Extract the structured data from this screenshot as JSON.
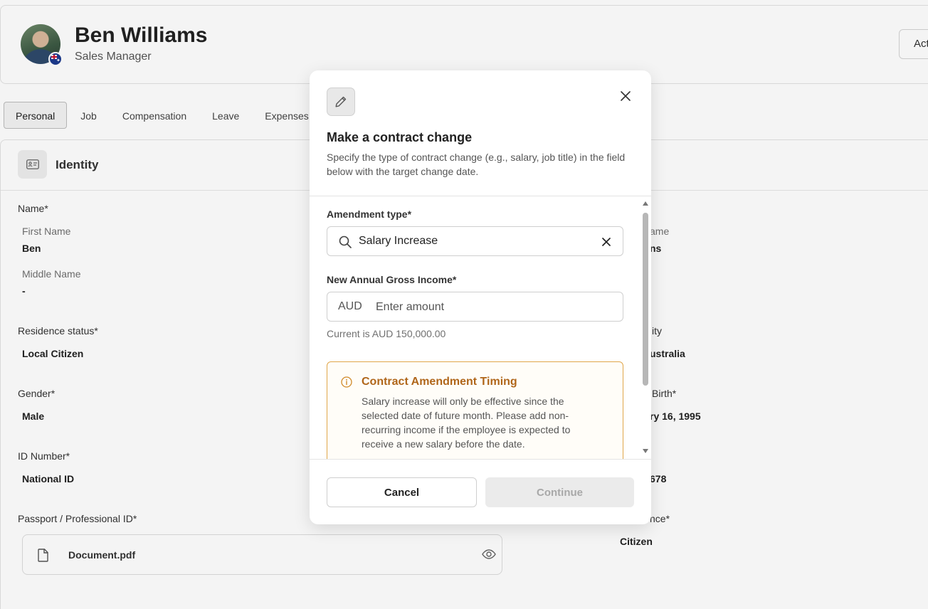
{
  "employee": {
    "name": "Ben Williams",
    "role": "Sales Manager",
    "actions_label": "Act"
  },
  "tabs": [
    {
      "label": "Personal",
      "active": true
    },
    {
      "label": "Job"
    },
    {
      "label": "Compensation"
    },
    {
      "label": "Leave"
    },
    {
      "label": "Expenses"
    }
  ],
  "identity": {
    "title": "Identity",
    "name_label": "Name*",
    "first_name_label": "First Name",
    "first_name": "Ben",
    "middle_name_label": "Middle Name",
    "middle_name": "-",
    "last_name_label_visible": "ame",
    "last_name_visible": "ns",
    "residence_label": "Residence status*",
    "residence": "Local Citizen",
    "nationality_label_visible": "ity",
    "nationality_visible": "ustralia",
    "gender_label": "Gender*",
    "gender": "Male",
    "dob_label_visible": "Birth*",
    "dob_visible": "ry 16, 1995",
    "id_label": "ID Number*",
    "id_type": "National ID",
    "id_number_visible": "678",
    "passport_label": "Passport / Professional ID*",
    "document_name": "Document.pdf",
    "right_bottom_label_visible": "nce*",
    "right_bottom_value": "Citizen"
  },
  "modal": {
    "title": "Make a contract change",
    "description": "Specify the type of contract change (e.g., salary, job title) in the field below with the target change date.",
    "amendment_label": "Amendment type*",
    "amendment_value": "Salary Increase",
    "income_label": "New Annual Gross Income*",
    "currency": "AUD",
    "amount_placeholder": "Enter amount",
    "current_hint": "Current is AUD 150,000.00",
    "alert_title": "Contract Amendment Timing",
    "alert_text": "Salary increase will only be effective since the selected date of future month. Please add non-recurring income if the employee is expected to receive a new salary before the date.",
    "cancel_label": "Cancel",
    "continue_label": "Continue"
  },
  "colors": {
    "warning": "#b0661a",
    "warning_border": "#e0a64a"
  }
}
